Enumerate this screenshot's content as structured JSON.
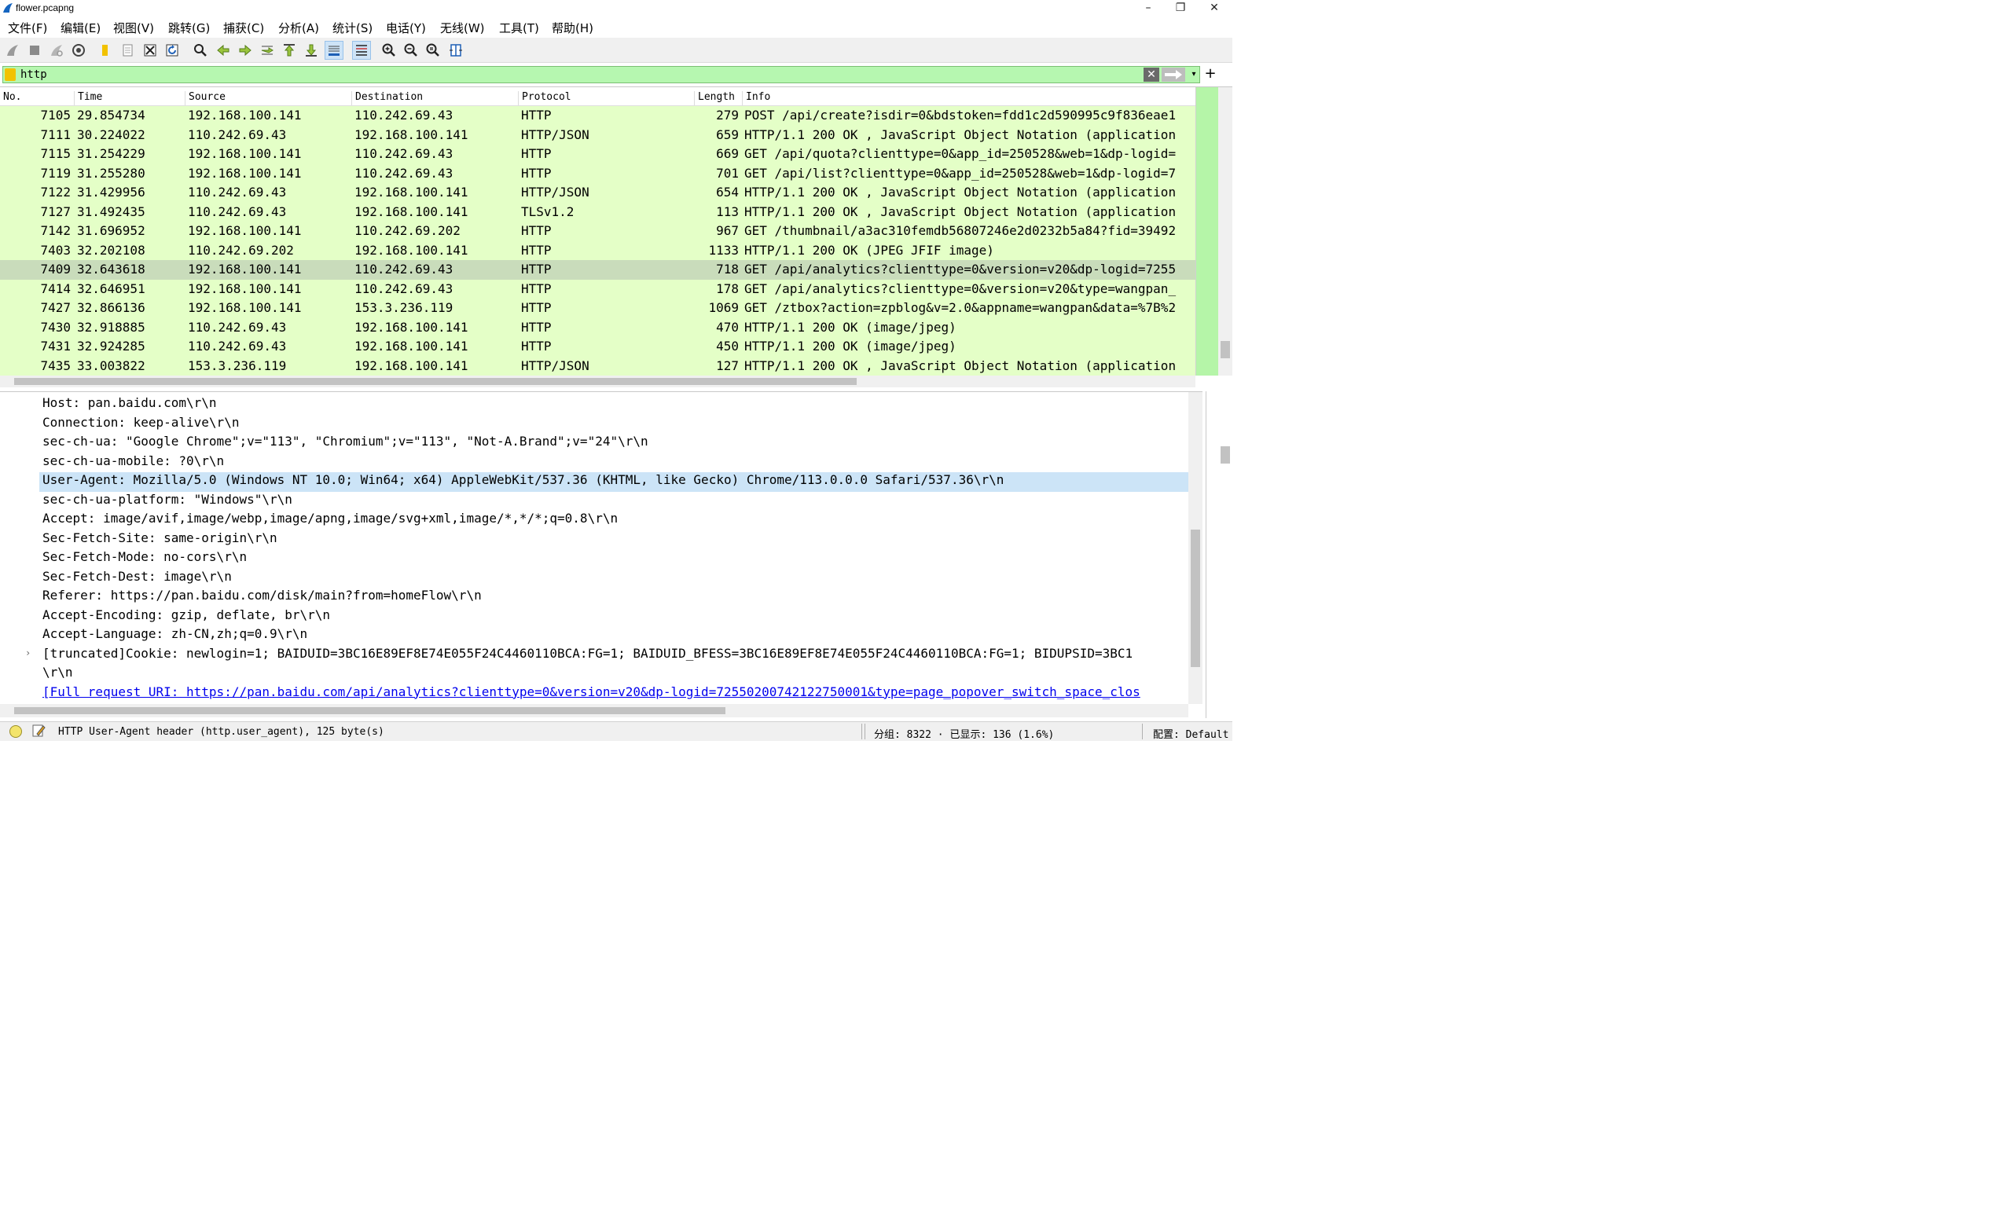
{
  "window": {
    "title": "flower.pcapng",
    "minimize": "–",
    "restore": "❐",
    "close": "✕"
  },
  "menu": [
    "文件(F)",
    "编辑(E)",
    "视图(V)",
    "跳转(G)",
    "捕获(C)",
    "分析(A)",
    "统计(S)",
    "电话(Y)",
    "无线(W)",
    "工具(T)",
    "帮助(H)"
  ],
  "toolbar": {
    "icons": [
      "shark-fin-start-icon",
      "stop-capture-icon",
      "restart-capture-icon",
      "capture-options-icon",
      "open-file-icon",
      "file-set-icon",
      "close-file-icon",
      "reload-icon",
      "find-packet-icon",
      "go-back-icon",
      "go-forward-icon",
      "go-to-packet-icon",
      "first-packet-icon",
      "last-packet-icon",
      "auto-scroll-icon",
      "colorize-icon",
      "zoom-in-icon",
      "zoom-out-icon",
      "normal-size-icon",
      "resize-columns-icon"
    ]
  },
  "filter": {
    "value": "http",
    "clear_glyph": "✕",
    "dropdown_glyph": "▾",
    "add_glyph": "+"
  },
  "packet_list": {
    "columns": [
      "No.",
      "Time",
      "Source",
      "Destination",
      "Protocol",
      "Length",
      "Info"
    ],
    "rows": [
      {
        "no": "7105",
        "time": "29.854734",
        "src": "192.168.100.141",
        "dst": "110.242.69.43",
        "proto": "HTTP",
        "len": "279",
        "info": "POST /api/create?isdir=0&bdstoken=fdd1c2d590995c9f836eae1"
      },
      {
        "no": "7111",
        "time": "30.224022",
        "src": "110.242.69.43",
        "dst": "192.168.100.141",
        "proto": "HTTP/JSON",
        "len": "659",
        "info": "HTTP/1.1 200 OK , JavaScript Object Notation (application"
      },
      {
        "no": "7115",
        "time": "31.254229",
        "src": "192.168.100.141",
        "dst": "110.242.69.43",
        "proto": "HTTP",
        "len": "669",
        "info": "GET /api/quota?clienttype=0&app_id=250528&web=1&dp-logid="
      },
      {
        "no": "7119",
        "time": "31.255280",
        "src": "192.168.100.141",
        "dst": "110.242.69.43",
        "proto": "HTTP",
        "len": "701",
        "info": "GET /api/list?clienttype=0&app_id=250528&web=1&dp-logid=7"
      },
      {
        "no": "7122",
        "time": "31.429956",
        "src": "110.242.69.43",
        "dst": "192.168.100.141",
        "proto": "HTTP/JSON",
        "len": "654",
        "info": "HTTP/1.1 200 OK , JavaScript Object Notation (application"
      },
      {
        "no": "7127",
        "time": "31.492435",
        "src": "110.242.69.43",
        "dst": "192.168.100.141",
        "proto": "TLSv1.2",
        "len": "113",
        "info": "HTTP/1.1 200 OK , JavaScript Object Notation (application"
      },
      {
        "no": "7142",
        "time": "31.696952",
        "src": "192.168.100.141",
        "dst": "110.242.69.202",
        "proto": "HTTP",
        "len": "967",
        "info": "GET /thumbnail/a3ac310femdb56807246e2d0232b5a84?fid=39492"
      },
      {
        "no": "7403",
        "time": "32.202108",
        "src": "110.242.69.202",
        "dst": "192.168.100.141",
        "proto": "HTTP",
        "len": "1133",
        "info": "HTTP/1.1 200 OK  (JPEG JFIF image)"
      },
      {
        "no": "7409",
        "time": "32.643618",
        "src": "192.168.100.141",
        "dst": "110.242.69.43",
        "proto": "HTTP",
        "len": "718",
        "info": "GET /api/analytics?clienttype=0&version=v20&dp-logid=7255",
        "selected": true
      },
      {
        "no": "7414",
        "time": "32.646951",
        "src": "192.168.100.141",
        "dst": "110.242.69.43",
        "proto": "HTTP",
        "len": "178",
        "info": "GET /api/analytics?clienttype=0&version=v20&type=wangpan_"
      },
      {
        "no": "7427",
        "time": "32.866136",
        "src": "192.168.100.141",
        "dst": "153.3.236.119",
        "proto": "HTTP",
        "len": "1069",
        "info": "GET /ztbox?action=zpblog&v=2.0&appname=wangpan&data=%7B%2"
      },
      {
        "no": "7430",
        "time": "32.918885",
        "src": "110.242.69.43",
        "dst": "192.168.100.141",
        "proto": "HTTP",
        "len": "470",
        "info": "HTTP/1.1 200 OK  (image/jpeg)"
      },
      {
        "no": "7431",
        "time": "32.924285",
        "src": "110.242.69.43",
        "dst": "192.168.100.141",
        "proto": "HTTP",
        "len": "450",
        "info": "HTTP/1.1 200 OK  (image/jpeg)"
      },
      {
        "no": "7435",
        "time": "33.003822",
        "src": "153.3.236.119",
        "dst": "192.168.100.141",
        "proto": "HTTP/JSON",
        "len": "127",
        "info": "HTTP/1.1 200 OK , JavaScript Object Notation (application"
      }
    ]
  },
  "details": {
    "lines": [
      {
        "text": "Host: pan.baidu.com\\r\\n"
      },
      {
        "text": "Connection: keep-alive\\r\\n"
      },
      {
        "text": "sec-ch-ua: \"Google Chrome\";v=\"113\", \"Chromium\";v=\"113\", \"Not-A.Brand\";v=\"24\"\\r\\n"
      },
      {
        "text": "sec-ch-ua-mobile: ?0\\r\\n"
      },
      {
        "text": "User-Agent: Mozilla/5.0 (Windows NT 10.0; Win64; x64) AppleWebKit/537.36 (KHTML, like Gecko) Chrome/113.0.0.0 Safari/537.36\\r\\n",
        "selected": true
      },
      {
        "text": "sec-ch-ua-platform: \"Windows\"\\r\\n"
      },
      {
        "text": "Accept: image/avif,image/webp,image/apng,image/svg+xml,image/*,*/*;q=0.8\\r\\n"
      },
      {
        "text": "Sec-Fetch-Site: same-origin\\r\\n"
      },
      {
        "text": "Sec-Fetch-Mode: no-cors\\r\\n"
      },
      {
        "text": "Sec-Fetch-Dest: image\\r\\n"
      },
      {
        "text": "Referer: https://pan.baidu.com/disk/main?from=homeFlow\\r\\n"
      },
      {
        "text": "Accept-Encoding: gzip, deflate, br\\r\\n"
      },
      {
        "text": "Accept-Language: zh-CN,zh;q=0.9\\r\\n"
      },
      {
        "text": " [truncated]Cookie: newlogin=1; BAIDUID=3BC16E89EF8E74E055F24C4460110BCA:FG=1; BAIDUID_BFESS=3BC16E89EF8E74E055F24C4460110BCA:FG=1; BIDUPSID=3BC1",
        "expander": "›"
      },
      {
        "text": "\\r\\n"
      },
      {
        "text": "[Full request URI: https://pan.baidu.com/api/analytics?clienttype=0&version=v20&dp-logid=72550200742122750001&type=page_popover_switch_space_clos",
        "link": true
      }
    ]
  },
  "status": {
    "field_text": "HTTP User-Agent header (http.user_agent), 125 byte(s)",
    "packets_text": "分组: 8322 · 已显示: 136 (1.6%)",
    "profile_text": "配置: Default"
  }
}
